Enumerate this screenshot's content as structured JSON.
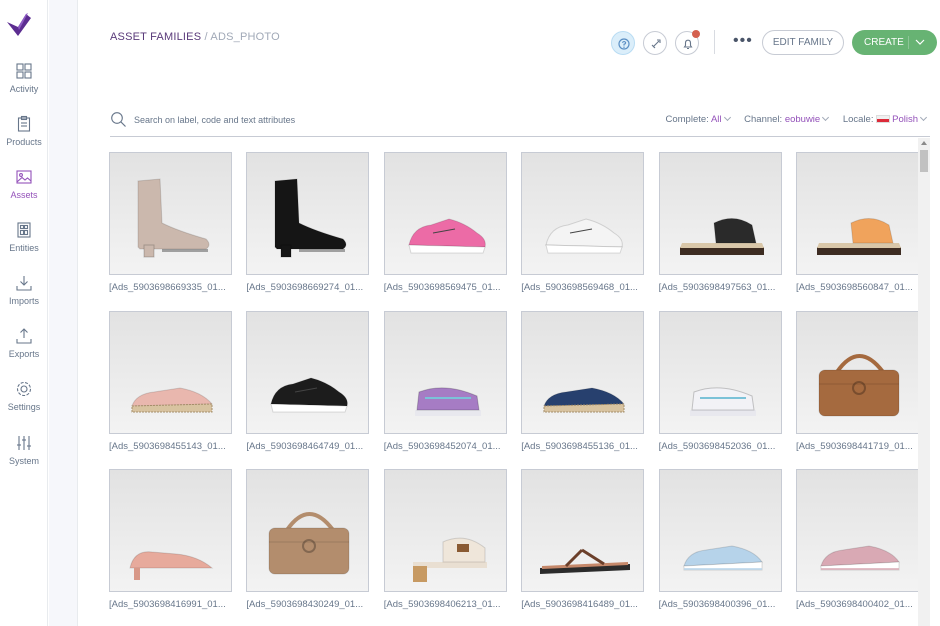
{
  "app": {
    "logo": "akeneo-logo"
  },
  "nav": [
    {
      "id": "activity",
      "label": "Activity",
      "icon": "dashboard-icon"
    },
    {
      "id": "products",
      "label": "Products",
      "icon": "clipboard-icon"
    },
    {
      "id": "assets",
      "label": "Assets",
      "icon": "image-icon",
      "active": true
    },
    {
      "id": "entities",
      "label": "Entities",
      "icon": "entities-icon"
    },
    {
      "id": "imports",
      "label": "Imports",
      "icon": "import-icon"
    },
    {
      "id": "exports",
      "label": "Exports",
      "icon": "export-icon"
    },
    {
      "id": "settings",
      "label": "Settings",
      "icon": "gear-icon"
    },
    {
      "id": "system",
      "label": "System",
      "icon": "sliders-icon"
    }
  ],
  "header": {
    "breadcrumb_root": "ASSET FAMILIES",
    "breadcrumb_sep": " / ",
    "breadcrumb_current": "ADS_PHOTO",
    "more_label": "•••",
    "edit_family_label": "EDIT FAMILY",
    "create_label": "CREATE"
  },
  "search": {
    "placeholder": "Search on label, code and text attributes",
    "complete_label": "Complete:",
    "complete_value": "All",
    "channel_label": "Channel:",
    "channel_value": "eobuwie",
    "locale_label": "Locale:",
    "locale_value": "Polish"
  },
  "colors": {
    "accent": "#9452ba",
    "create": "#67b373",
    "notification": "#d4604f"
  },
  "assets": [
    {
      "label": "[Ads_5903698669335_01...",
      "kind": "boot",
      "color": "#cbb8ad"
    },
    {
      "label": "[Ads_5903698669274_01...",
      "kind": "boot",
      "color": "#151515"
    },
    {
      "label": "[Ads_5903698569475_01...",
      "kind": "sneaker",
      "color": "#ec6ba6"
    },
    {
      "label": "[Ads_5903698569468_01...",
      "kind": "sneaker",
      "color": "#f4f4f4"
    },
    {
      "label": "[Ads_5903698497563_01...",
      "kind": "slide",
      "color": "#2a2a2a"
    },
    {
      "label": "[Ads_5903698560847_01...",
      "kind": "slide",
      "color": "#f0a35c"
    },
    {
      "label": "[Ads_5903698455143_01...",
      "kind": "espadrille",
      "color": "#e9b7ae"
    },
    {
      "label": "[Ads_5903698464749_01...",
      "kind": "sneaker",
      "color": "#1c1c1c"
    },
    {
      "label": "[Ads_5903698452074_01...",
      "kind": "sandal",
      "color": "#a67cc4"
    },
    {
      "label": "[Ads_5903698455136_01...",
      "kind": "espadrille",
      "color": "#27406e"
    },
    {
      "label": "[Ads_5903698452036_01...",
      "kind": "sandal",
      "color": "#f2f2f6"
    },
    {
      "label": "[Ads_5903698441719_01...",
      "kind": "bag",
      "color": "#a56a3f"
    },
    {
      "label": "[Ads_5903698416991_01...",
      "kind": "pump",
      "color": "#e7aa9c"
    },
    {
      "label": "[Ads_5903698430249_01...",
      "kind": "bag",
      "color": "#b38d6d"
    },
    {
      "label": "[Ads_5903698406213_01...",
      "kind": "mule",
      "color": "#efe6da"
    },
    {
      "label": "[Ads_5903698416489_01...",
      "kind": "flipflop",
      "color": "#c5886a"
    },
    {
      "label": "[Ads_5903698400396_01...",
      "kind": "slipon",
      "color": "#b6d3ea"
    },
    {
      "label": "[Ads_5903698400402_01...",
      "kind": "slipon",
      "color": "#d9a9b4"
    }
  ]
}
